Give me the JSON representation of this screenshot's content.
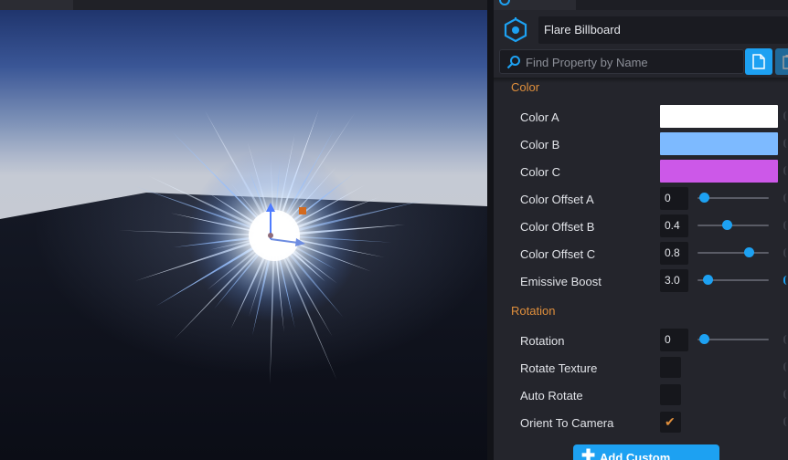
{
  "object_name": "Flare Billboard",
  "search": {
    "placeholder": "Find Property by Name"
  },
  "icons": {
    "object": "hexagon-object-icon",
    "search": "search-icon",
    "document": "document-icon",
    "clipboard": "clipboard-icon",
    "add": "plus-icon",
    "checkmark": "checkmark-icon",
    "gizmo": "transform-gizmo-icon"
  },
  "colors": {
    "accent": "#1da1f2",
    "section_header": "#e08f3c",
    "color_a": "#ffffff",
    "color_b": "#7dbaff",
    "color_c": "#cc58e8"
  },
  "sections": {
    "color": {
      "title": "Color",
      "color_a_label": "Color A",
      "color_b_label": "Color B",
      "color_c_label": "Color C",
      "offset_a_label": "Color Offset A",
      "offset_a_value": "0",
      "offset_a_fraction": 0.0,
      "offset_b_label": "Color Offset B",
      "offset_b_value": "0.4",
      "offset_b_fraction": 0.4,
      "offset_c_label": "Color Offset C",
      "offset_c_value": "0.8",
      "offset_c_fraction": 0.8,
      "emissive_label": "Emissive Boost",
      "emissive_value": "3.0",
      "emissive_fraction": 0.04
    },
    "rotation": {
      "title": "Rotation",
      "rotation_label": "Rotation",
      "rotation_value": "0",
      "rotation_fraction": 0.0,
      "rotate_texture_label": "Rotate Texture",
      "rotate_texture_checked": false,
      "auto_rotate_label": "Auto Rotate",
      "auto_rotate_checked": false,
      "orient_label": "Orient To Camera",
      "orient_checked": true
    }
  },
  "add_button_label": "Add Custom Property"
}
